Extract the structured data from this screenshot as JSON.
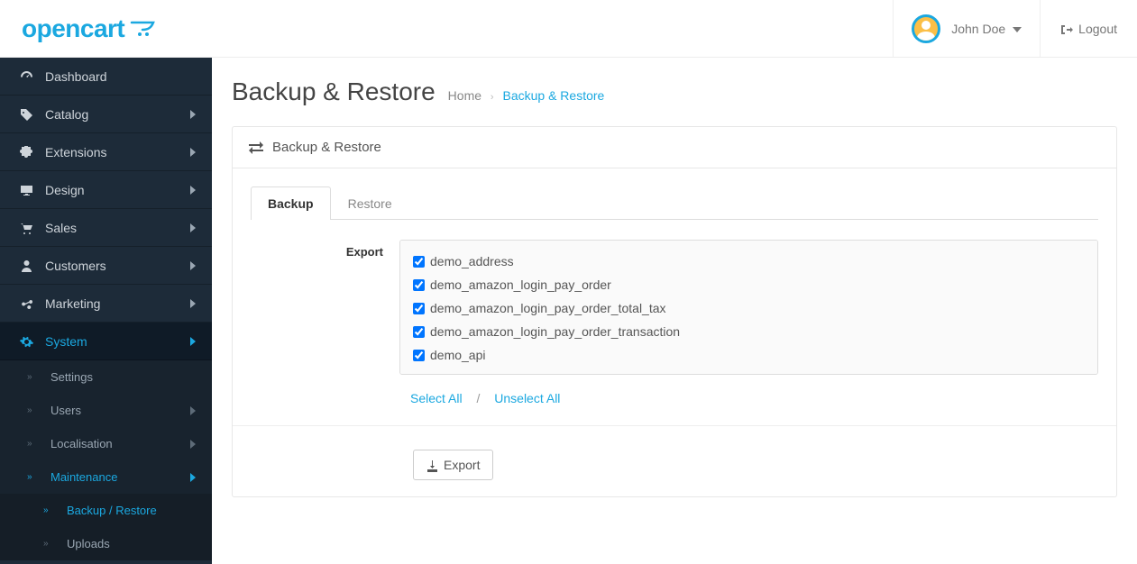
{
  "header": {
    "brand": "opencart",
    "user_name": "John Doe",
    "logout": "Logout"
  },
  "sidebar": {
    "dashboard": "Dashboard",
    "catalog": "Catalog",
    "extensions": "Extensions",
    "design": "Design",
    "sales": "Sales",
    "customers": "Customers",
    "marketing": "Marketing",
    "system": "System",
    "system_sub": {
      "settings": "Settings",
      "users": "Users",
      "localisation": "Localisation",
      "maintenance": "Maintenance",
      "maintenance_sub": {
        "backup_restore": "Backup / Restore",
        "uploads": "Uploads"
      }
    }
  },
  "page": {
    "title": "Backup & Restore",
    "crumb_home": "Home",
    "crumb_current": "Backup & Restore"
  },
  "panel": {
    "heading": "Backup & Restore",
    "tabs": {
      "backup": "Backup",
      "restore": "Restore"
    },
    "export_label": "Export",
    "tables": [
      "demo_address",
      "demo_amazon_login_pay_order",
      "demo_amazon_login_pay_order_total_tax",
      "demo_amazon_login_pay_order_transaction",
      "demo_api"
    ],
    "select_all": "Select All",
    "unselect_all": "Unselect All",
    "export_button": "Export"
  }
}
